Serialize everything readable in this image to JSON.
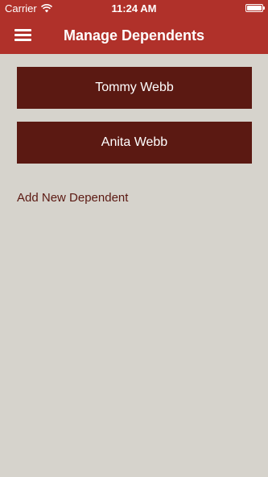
{
  "status_bar": {
    "carrier": "Carrier",
    "time": "11:24 AM",
    "wifi_icon": "wifi-icon",
    "battery_icon": "battery-icon"
  },
  "nav": {
    "title": "Manage Dependents",
    "menu_icon": "hamburger-menu-icon",
    "background_color": "#b0312a"
  },
  "dependents": [
    {
      "name": "Tommy Webb"
    },
    {
      "name": "Anita Webb"
    }
  ],
  "add_dependent_label": "Add New Dependent",
  "colors": {
    "accent": "#b0312a",
    "button": "#5b1912",
    "background": "#d6d3cc"
  }
}
